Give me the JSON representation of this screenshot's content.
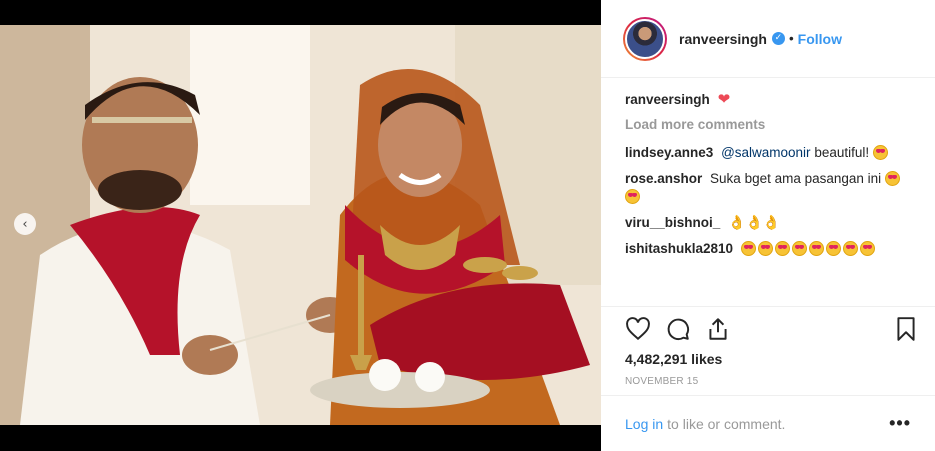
{
  "post": {
    "username": "ranveersingh",
    "follow_label": "Follow",
    "dot": "•",
    "verified_mark": "✓"
  },
  "comments": {
    "caption_user": "ranveersingh",
    "caption_heart": "❤",
    "load_more": "Load more comments",
    "items": [
      {
        "user": "lindsey.anne3",
        "mention": "@salwamoonir",
        "text": "beautiful!"
      },
      {
        "user": "rose.anshor",
        "text": "Suka bget ama pasangan ini"
      },
      {
        "user": "viru__bishnoi_",
        "text": "👌👌👌"
      },
      {
        "user": "ishitashukla2810",
        "text": ""
      }
    ]
  },
  "stats": {
    "likes": "4,482,291 likes",
    "date": "NOVEMBER 15"
  },
  "footer": {
    "login": "Log in",
    "rest": "to like or comment.",
    "more": "•••"
  },
  "carousel": {
    "prev_arrow": "‹"
  },
  "icons": [
    "heart-outline-icon",
    "comment-icon",
    "share-icon",
    "bookmark-icon",
    "verified-badge-icon",
    "chevron-left-icon"
  ]
}
